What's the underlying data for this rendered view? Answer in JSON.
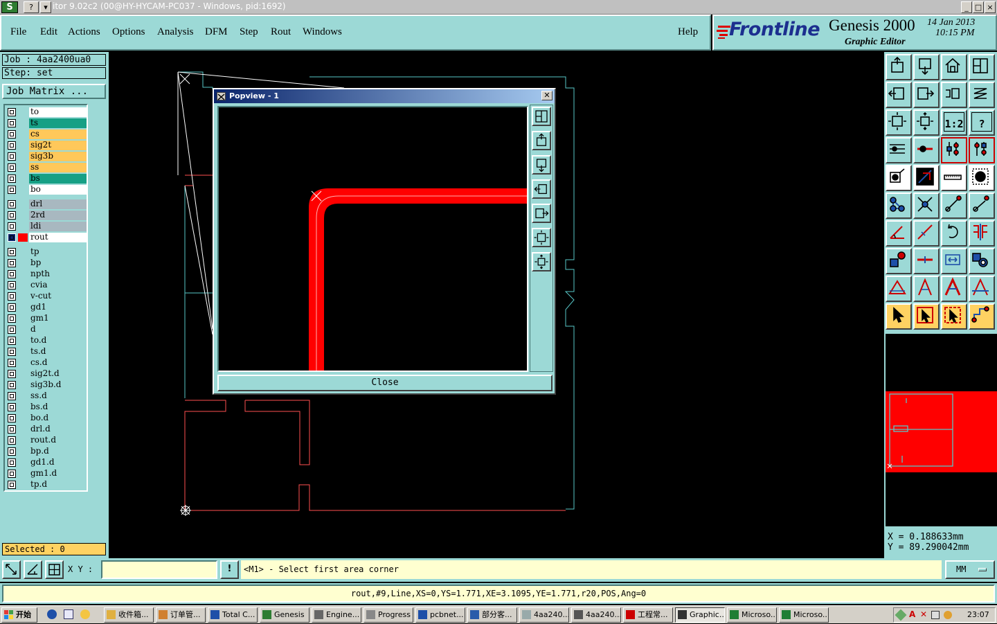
{
  "window": {
    "title": "itor 9.02c2 (00@HY-HYCAM-PC037 - Windows, pid:1692)",
    "controls": [
      "_",
      "□",
      "×"
    ]
  },
  "menu": [
    "File",
    "Edit",
    "Actions",
    "Options",
    "Analysis",
    "DFM",
    "Step",
    "Rout",
    "Windows"
  ],
  "help_label": "Help",
  "brand": {
    "logo": "Frontline",
    "product": "Genesis 2000",
    "subtitle": "Graphic Editor",
    "date": "14 Jan 2013",
    "time": "10:15 PM"
  },
  "job": {
    "job_label": "Job : 4aa2400ua0",
    "step_label": "Step: set",
    "matrix_button": "Job Matrix ..."
  },
  "layers": [
    {
      "name": "to",
      "color": "#ffffff"
    },
    {
      "name": "ts",
      "color": "#16a085"
    },
    {
      "name": "cs",
      "color": "#ffc85a"
    },
    {
      "name": "sig2t",
      "color": "#ffc85a"
    },
    {
      "name": "sig3b",
      "color": "#ffc85a"
    },
    {
      "name": "ss",
      "color": "#ffc85a"
    },
    {
      "name": "bs",
      "color": "#16a085"
    },
    {
      "name": "bo",
      "color": "#ffffff"
    },
    {
      "name": "drl",
      "color": "#a8b8c0"
    },
    {
      "name": "2rd",
      "color": "#a8b8c0"
    },
    {
      "name": "ldi",
      "color": "#a8b8c0"
    },
    {
      "name": "rout",
      "color": "#ffffff",
      "work": true
    },
    {
      "name": "tp",
      "color": "#9cd9d6"
    },
    {
      "name": "bp",
      "color": "#9cd9d6"
    },
    {
      "name": "npth",
      "color": "#9cd9d6"
    },
    {
      "name": "cvia",
      "color": "#9cd9d6"
    },
    {
      "name": "v-cut",
      "color": "#9cd9d6"
    },
    {
      "name": "gd1",
      "color": "#9cd9d6"
    },
    {
      "name": "gm1",
      "color": "#9cd9d6"
    },
    {
      "name": "d",
      "color": "#9cd9d6"
    },
    {
      "name": "to.d",
      "color": "#9cd9d6"
    },
    {
      "name": "ts.d",
      "color": "#9cd9d6"
    },
    {
      "name": "cs.d",
      "color": "#9cd9d6"
    },
    {
      "name": "sig2t.d",
      "color": "#9cd9d6"
    },
    {
      "name": "sig3b.d",
      "color": "#9cd9d6"
    },
    {
      "name": "ss.d",
      "color": "#9cd9d6"
    },
    {
      "name": "bs.d",
      "color": "#9cd9d6"
    },
    {
      "name": "bo.d",
      "color": "#9cd9d6"
    },
    {
      "name": "drl.d",
      "color": "#9cd9d6"
    },
    {
      "name": "rout.d",
      "color": "#9cd9d6"
    },
    {
      "name": "bp.d",
      "color": "#9cd9d6"
    },
    {
      "name": "gd1.d",
      "color": "#9cd9d6"
    },
    {
      "name": "gm1.d",
      "color": "#9cd9d6"
    },
    {
      "name": "tp.d",
      "color": "#9cd9d6"
    }
  ],
  "selected_label": "Selected : 0",
  "popview": {
    "title": "Popview - 1",
    "close_label": "Close",
    "tools": [
      "zoom-window-icon",
      "pan-up-icon",
      "pan-down-icon",
      "pan-left-icon",
      "pan-right-icon",
      "zoom-home-icon",
      "zoom-out-icon"
    ]
  },
  "toolbox": {
    "tools": [
      {
        "icon": "pan-up-icon"
      },
      {
        "icon": "pan-down-icon"
      },
      {
        "icon": "home-icon"
      },
      {
        "icon": "zoom-window-icon"
      },
      {
        "icon": "pan-left-icon"
      },
      {
        "icon": "pan-right-icon"
      },
      {
        "icon": "undo-zoom-icon"
      },
      {
        "icon": "redraw-icon"
      },
      {
        "icon": "zoom-in-icon"
      },
      {
        "icon": "zoom-out-icon"
      },
      {
        "icon": "ratio-icon",
        "text": "1:2"
      },
      {
        "icon": "help-icon",
        "text": "?"
      },
      {
        "icon": "layers-icon"
      },
      {
        "icon": "snap-icon"
      },
      {
        "icon": "net-highlight-icon",
        "active": true
      },
      {
        "icon": "net-select-icon",
        "active": true
      },
      {
        "icon": "feature-info-icon",
        "bg": "white"
      },
      {
        "icon": "measure-icon",
        "bg": "white"
      },
      {
        "icon": "ruler-icon",
        "bg": "white"
      },
      {
        "icon": "pad-icon",
        "bg": "white"
      },
      {
        "icon": "connect-icon"
      },
      {
        "icon": "cross-icon"
      },
      {
        "icon": "line-add-icon"
      },
      {
        "icon": "line-end-icon"
      },
      {
        "icon": "angle-icon"
      },
      {
        "icon": "slope-icon"
      },
      {
        "icon": "arc-icon"
      },
      {
        "icon": "mirror-icon"
      },
      {
        "icon": "move-pad-icon"
      },
      {
        "icon": "split-icon"
      },
      {
        "icon": "resize-icon"
      },
      {
        "icon": "group-icon"
      },
      {
        "icon": "triangle-outline-icon"
      },
      {
        "icon": "triangle-a-icon"
      },
      {
        "icon": "triangle-fill-icon"
      },
      {
        "icon": "triangle-line-icon"
      },
      {
        "icon": "select-arrow-icon",
        "bg": "yellow"
      },
      {
        "icon": "select-box-icon",
        "bg": "yellow"
      },
      {
        "icon": "select-lasso-icon",
        "bg": "yellow"
      },
      {
        "icon": "select-path-icon",
        "bg": "yellow"
      }
    ]
  },
  "coords": {
    "x_label": "X  =  0.188633mm",
    "y_label": "Y  =  89.290042mm"
  },
  "command": {
    "xy_label": "X Y :",
    "xy_value": "",
    "prompt": "<M1> - Select first area corner",
    "units": "MM"
  },
  "status_text": "rout,#9,Line,XS=0,YS=1.771,XE=3.1095,YE=1.771,r20,POS,Ang=0",
  "taskbar": {
    "start_label": "开始",
    "tasks": [
      {
        "label": "收件箱...",
        "icon": "mail-icon"
      },
      {
        "label": "订单管...",
        "icon": "order-icon"
      },
      {
        "label": "Total C...",
        "icon": "total-commander-icon"
      },
      {
        "label": "Genesis",
        "icon": "genesis-icon"
      },
      {
        "label": "Engine...",
        "icon": "engine-icon"
      },
      {
        "label": "Progress",
        "icon": "progress-icon"
      },
      {
        "label": "pcbnet...",
        "icon": "pcbnet-icon"
      },
      {
        "label": "部分客...",
        "icon": "word-icon"
      },
      {
        "label": "4aa240...",
        "icon": "notepad-icon"
      },
      {
        "label": "4aa240...",
        "icon": "window-icon"
      },
      {
        "label": "工程常...",
        "icon": "pdf-icon"
      },
      {
        "label": "Graphic...",
        "icon": "graphic-icon",
        "pressed": true
      },
      {
        "label": "Microso...",
        "icon": "excel-icon"
      },
      {
        "label": "Microso...",
        "icon": "excel-icon"
      }
    ],
    "clock": "23:07"
  }
}
